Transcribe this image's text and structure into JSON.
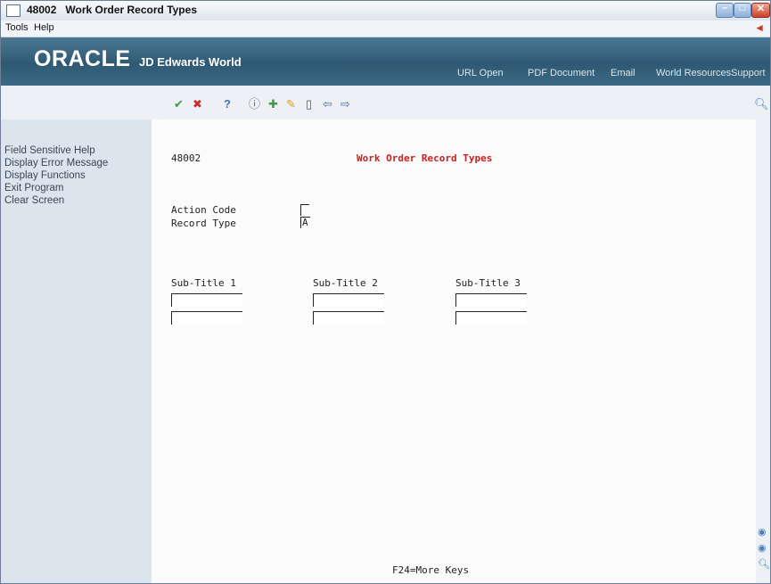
{
  "window": {
    "program": "48002",
    "title": "Work Order Record Types"
  },
  "menu": {
    "tools": "Tools",
    "help": "Help"
  },
  "banner": {
    "brand": "ORACLE",
    "product": "JD Edwards World",
    "links": [
      "URL Open",
      "PDF Document",
      "Email",
      "World Resources",
      "Support"
    ]
  },
  "toolbar": {
    "icons": [
      "check-icon",
      "cancel-icon",
      "help-icon",
      "inquire-icon",
      "add-icon",
      "change-icon",
      "delete-icon",
      "previous-icon",
      "next-icon",
      "search-icon"
    ],
    "help_symbol": "?"
  },
  "sidebar": {
    "items": [
      "Field Sensitive Help",
      "Display Error Message",
      "Display Functions",
      "Exit Program",
      "Clear Screen"
    ]
  },
  "form": {
    "program_id": "48002",
    "heading": "Work Order Record Types",
    "action_code_label": "Action Code",
    "action_code_value": "",
    "record_type_label": "Record Type",
    "record_type_value": "A",
    "subtitles": [
      {
        "label": "Sub-Title 1",
        "line1": "",
        "line2": ""
      },
      {
        "label": "Sub-Title 2",
        "line1": "",
        "line2": ""
      },
      {
        "label": "Sub-Title 3",
        "line1": "",
        "line2": ""
      }
    ],
    "footer": "F24=More Keys"
  },
  "colors": {
    "banner": "#2f5973",
    "sidebar": "#dce5ee",
    "heading": "#cc2020"
  }
}
